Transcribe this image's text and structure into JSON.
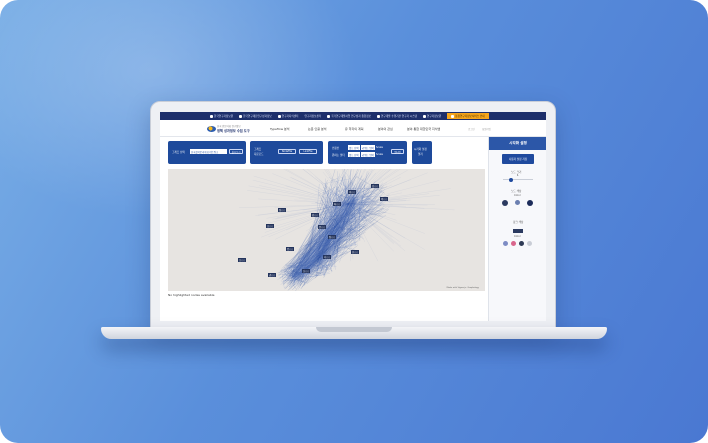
{
  "topbar": {
    "items": [
      {
        "label": "한국연구자정보원",
        "icon": "home-icon"
      },
      {
        "label": "한국연구재단연구성과정보",
        "icon": "document-icon"
      },
      {
        "label": "연구자지식센터",
        "icon": "document-icon"
      },
      {
        "label": "연구자정보센터",
        "icon": "document-icon"
      },
      {
        "label": "국가연구개발사업 연구성과 종합정보",
        "icon": "globe-icon"
      },
      {
        "label": "연구개발 수행기관 연구자 시스템",
        "icon": "document-icon"
      },
      {
        "label": "연구자정보원",
        "icon": "document-icon"
      },
      {
        "label": "통합연구자정보서비스 안내",
        "icon": "star-icon",
        "highlight": true
      }
    ]
  },
  "nav": {
    "logo_line1": "한국 인문사회 연구정보",
    "logo_line2": "정책 성과정보 수집 도구",
    "menus": [
      "Typeflow 분석",
      "논문 인용 분석",
      "유 학자의 계획",
      "분야의 관심",
      "분야 통합 대한민국 지식맵"
    ],
    "utils": [
      "로그인",
      "회원가입"
    ]
  },
  "panel1": {
    "label": "그래프 선택",
    "select": "한국철학분과학회 네트워크",
    "button": "불러오기"
  },
  "panel2": {
    "line1": "그래프",
    "line2": "다운로드",
    "buttons": [
      "NodeFile",
      "LinkFile"
    ]
  },
  "panel3": {
    "row1_label": "인용인",
    "row1_field1": "필드 선택",
    "row1_field2": "키워드 입력",
    "row1_suffix": "Scale",
    "row2_label": "원하는 필터",
    "row2_field1": "필드 선택",
    "row2_field2": "키워드 입력",
    "row2_suffix": "Scale",
    "button": "필터링"
  },
  "panel4": {
    "line1": "시각화 설정",
    "line2": "열기"
  },
  "graph": {
    "node_labels": [
      "김○○",
      "이○○",
      "박○○",
      "최○○",
      "정○○",
      "강○○",
      "조○○",
      "윤○○",
      "장○○",
      "임○○",
      "한○○",
      "오○○",
      "서○○",
      "신○○",
      "권○○"
    ],
    "credit": "Made with Sigma.js, Graphology",
    "footnote": "No highlighted nodes available"
  },
  "sidebar": {
    "title": "시각화 설정",
    "button": "사용자 설정 저장",
    "node_size_label": "노드 크기",
    "node_size_value": "1",
    "node_size_fraction": 0.2,
    "node_color_label": "노드 색상",
    "node_color_sub": "Color",
    "edge_color_label": "링크 색상",
    "edge_color_sub": "Color",
    "palette_top": [
      "#2b3a60",
      "#6b7fb0",
      "#1c2c5a"
    ],
    "palette_bottom": [
      "#7d8cc4",
      "#d9668c",
      "#2e3a55",
      "#c9cdd6"
    ],
    "colors": {
      "accent": "#1e4a9b",
      "topbar": "#1d2f6b",
      "highlight": "#f6a51a"
    }
  }
}
